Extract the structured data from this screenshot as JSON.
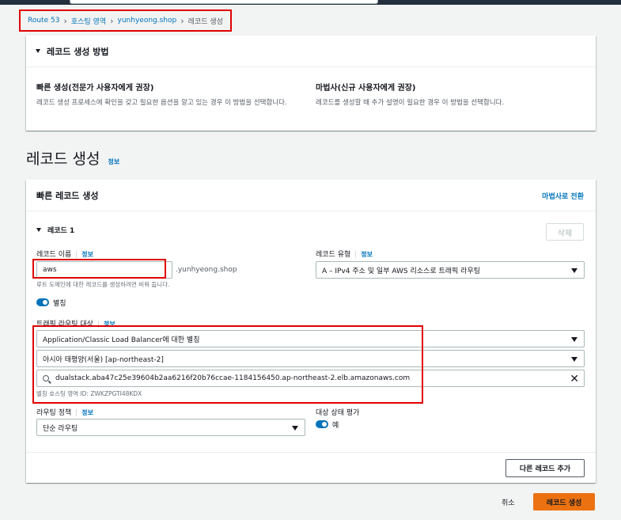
{
  "breadcrumb": {
    "items": [
      "Route 53",
      "호스팅 영역",
      "yunhyeong.shop"
    ],
    "current": "레코드 생성"
  },
  "method_panel": {
    "title": "레코드 생성 방법",
    "quick": {
      "title": "빠른 생성(전문가 사용자에게 권장)",
      "desc": "레코드 생성 프로세스에 확인을 갖고 필요한 옵션을 알고 있는 경우 이 방법을 선택합니다."
    },
    "wizard": {
      "title": "마법사(신규 사용자에게 권장)",
      "desc": "레코드를 생성할 때 추가 설명이 필요한 경우 이 방법을 선택합니다."
    }
  },
  "page": {
    "title": "레코드 생성",
    "info": "정보"
  },
  "form": {
    "header": "빠른 레코드 생성",
    "switch_label": "마법사로 전환",
    "record_title": "레코드 1",
    "delete_label": "삭제",
    "record_name": {
      "label": "레코드 이름",
      "info": "정보",
      "value": "aws",
      "suffix": ".yunhyeong.shop",
      "hint": "루트 도메인에 대한 레코드를 생성하려면 비워 둡니다."
    },
    "record_type": {
      "label": "레코드 유형",
      "info": "정보",
      "value": "A – IPv4 주소 및 일부 AWS 리소스로 트래픽 라우팅"
    },
    "alias": {
      "label": "별칭",
      "enabled": true
    },
    "target": {
      "label": "트래픽 라우팅 대상",
      "info": "정보",
      "endpoint": "Application/Classic Load Balancer에 대한 별칭",
      "region": "아시아 태평양(서울) [ap-northeast-2]",
      "lb": "dualstack.aba47c25e39604b2aa6216f20b76ccae-1184156450.ap-northeast-2.elb.amazonaws.com",
      "zone_hint": "별칭 호스팅 영역 ID: ZWKZPGTI48KDX"
    },
    "routing": {
      "label": "라우팅 정책",
      "info": "정보",
      "value": "단순 라우팅"
    },
    "health": {
      "label": "대상 상태 평가",
      "toggle_label": "예"
    },
    "add_label": "다른 레코드 추가"
  },
  "actions": {
    "cancel": "취소",
    "create": "레코드 생성"
  },
  "colors": {
    "link": "#0073bb",
    "primary": "#ec7211",
    "highlight": "#e00000"
  }
}
